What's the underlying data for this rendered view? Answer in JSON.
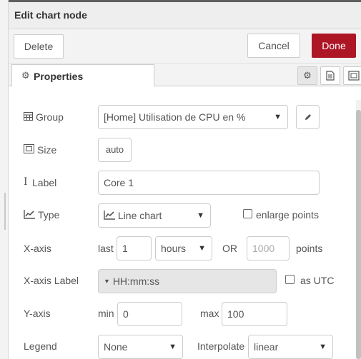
{
  "dialog": {
    "title": "Edit chart node"
  },
  "toolbar": {
    "delete_label": "Delete",
    "cancel_label": "Cancel",
    "done_label": "Done"
  },
  "tabs": {
    "properties_label": "Properties"
  },
  "form": {
    "group": {
      "label": "Group",
      "value": "[Home] Utilisation de CPU en %"
    },
    "size": {
      "label": "Size",
      "value": "auto"
    },
    "label": {
      "label": "Label",
      "value": "Core 1"
    },
    "type": {
      "label": "Type",
      "value": "Line chart",
      "enlarge_label": "enlarge points",
      "enlarge_checked": false
    },
    "xaxis": {
      "label": "X-axis",
      "last_label": "last",
      "last_value": "1",
      "unit_value": "hours",
      "or_label": "OR",
      "points_placeholder": "1000",
      "points_label": "points"
    },
    "xaxis_label": {
      "label": "X-axis Label",
      "value": "HH:mm:ss",
      "utc_label": "as UTC",
      "utc_checked": false
    },
    "yaxis": {
      "label": "Y-axis",
      "min_label": "min",
      "min_value": "0",
      "max_label": "max",
      "max_value": "100"
    },
    "legend": {
      "label": "Legend",
      "value": "None",
      "interpolate_label": "Interpolate",
      "interpolate_value": "linear"
    }
  },
  "colors": {
    "primary": "#ad1625",
    "border": "#cccccc",
    "text": "#555555"
  }
}
